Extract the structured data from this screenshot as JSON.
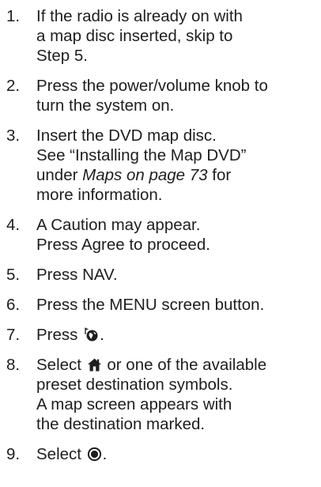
{
  "steps": [
    {
      "number": "1.",
      "lines": [
        "If the radio is already on with",
        "a map disc inserted, skip to",
        "Step 5."
      ]
    },
    {
      "number": "2.",
      "lines": [
        "Press the power/volume knob to",
        "turn the system on."
      ]
    },
    {
      "number": "3.",
      "line1": "Insert the DVD map disc.",
      "line2": "See “Installing the Map DVD”",
      "line3_prefix": "under ",
      "line3_italic": "Maps on page 73",
      "line3_suffix": " for",
      "line4": "more information."
    },
    {
      "number": "4.",
      "lines": [
        "A Caution may appear.",
        "Press Agree to proceed."
      ]
    },
    {
      "number": "5.",
      "lines": [
        "Press NAV."
      ]
    },
    {
      "number": "6.",
      "lines": [
        "Press the MENU screen button."
      ]
    },
    {
      "number": "7.",
      "prefix": "Press ",
      "icon": "destination-globe-icon",
      "suffix": "."
    },
    {
      "number": "8.",
      "prefix": "Select ",
      "icon": "home-icon",
      "line1_suffix": " or one of the available",
      "lines": [
        "preset destination symbols.",
        "A map screen appears with",
        "the destination marked."
      ]
    },
    {
      "number": "9.",
      "prefix": "Select ",
      "icon": "target-circle-icon",
      "suffix": "."
    }
  ]
}
